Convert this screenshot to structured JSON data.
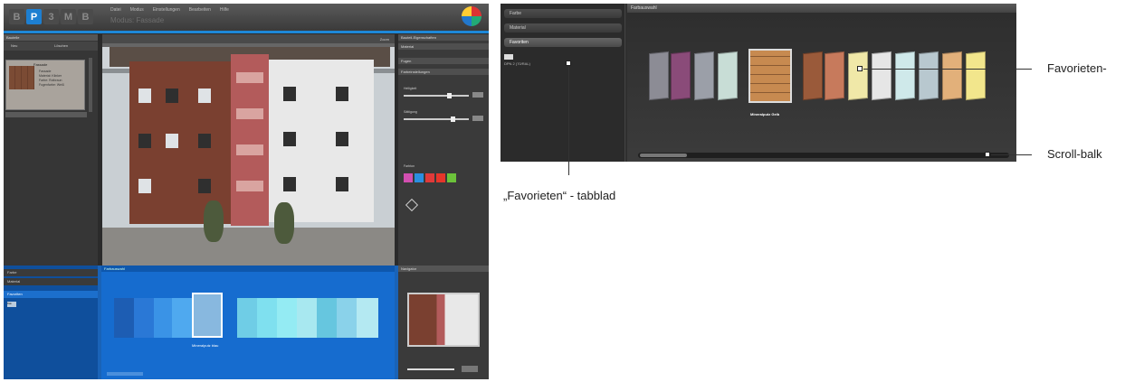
{
  "left_app": {
    "logo_letters": [
      "B",
      "P",
      "3",
      "M",
      "B"
    ],
    "menu": [
      "Datei",
      "Modus",
      "Einstellungen",
      "Bearbeiten",
      "Hilfe"
    ],
    "subtitle": "Modus: Fassade",
    "sidebar_title": "Bauteile",
    "toolbar": [
      "Neu",
      "Löschen"
    ],
    "swatch_title": "Fassade",
    "swatch_lines": [
      "Fassade",
      "Material: Klinker",
      "Farbe: Rotbraun",
      "Fugenfarbe: Weiß"
    ],
    "photo_toolbar_label": "Zoom",
    "right_panel": {
      "headers": [
        "Bauteil-Eigenschaften",
        "Material",
        "Fugen",
        "Farbeinstellungen"
      ],
      "labels": [
        "Helligkeit",
        "Sättigung",
        "Farbton"
      ],
      "color_chips": [
        "#d24fb0",
        "#2b8fe0",
        "#e03a3a",
        "#e6352a",
        "#6cc23a"
      ]
    },
    "bottom_tabs": [
      "Farbe",
      "Material",
      "Favoriten"
    ],
    "bottom_chip": "Kat.",
    "bottom_center_title": "Farbauswahl",
    "bottom_selected_caption": "Mineralputz blau",
    "bottom_nav_title": "Navigator"
  },
  "detail": {
    "tabs": [
      "Farbe",
      "Material",
      "Favoriten"
    ],
    "chip_label": "DPN 2 (70/RAL)",
    "header": "Farbauswahl",
    "cards": [
      {
        "color": "#8c8c95"
      },
      {
        "color": "#8a4b79"
      },
      {
        "color": "#9b9fa8"
      },
      {
        "color": "#c8ddd6"
      },
      {
        "color": "#c78a50"
      },
      {
        "color": "#9a5a3a"
      },
      {
        "color": "#c77a5c"
      },
      {
        "color": "#f0e8a8"
      },
      {
        "color": "#e6e6e6"
      },
      {
        "color": "#cfe9ea"
      },
      {
        "color": "#b8c8cf"
      },
      {
        "color": "#e2b07a"
      },
      {
        "color": "#f2e68c"
      }
    ],
    "selected_caption": "Mineralputz Gelb"
  },
  "callouts": {
    "favorieten_item": "Favorieten-",
    "scroll_bar": "Scroll-balk",
    "favorieten_tab": "„Favorieten“ - tabblad"
  }
}
